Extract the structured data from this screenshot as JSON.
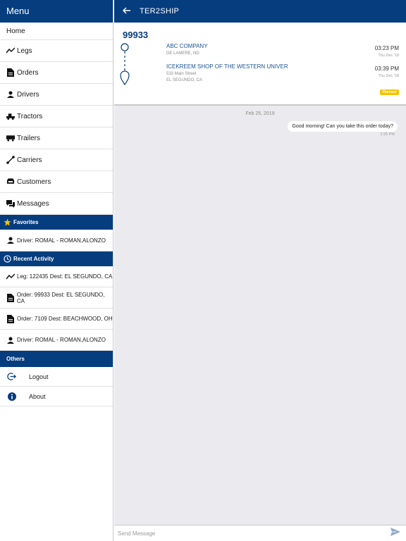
{
  "sidebar": {
    "title": "Menu",
    "home": "Home",
    "items": [
      {
        "label": "Legs",
        "icon": "trend-icon"
      },
      {
        "label": "Orders",
        "icon": "document-icon"
      },
      {
        "label": "Drivers",
        "icon": "person-icon"
      },
      {
        "label": "Tractors",
        "icon": "tractor-icon"
      },
      {
        "label": "Trailers",
        "icon": "trailer-icon"
      },
      {
        "label": "Carriers",
        "icon": "route-icon"
      },
      {
        "label": "Customers",
        "icon": "customers-icon"
      },
      {
        "label": "Messages",
        "icon": "chat-icon"
      }
    ],
    "favorites": {
      "title": "Favorites",
      "items": [
        {
          "label": "Driver: ROMAL - ROMAN,ALONZO"
        }
      ]
    },
    "recent": {
      "title": "Recent Activity",
      "items": [
        {
          "label": "Leg: 122435 Dest: EL SEGUNDO, CA"
        },
        {
          "label": "Order: 99933 Dest: EL SEGUNDO, CA"
        },
        {
          "label": "Order: 7109 Dest: BEACHWOOD, OH"
        },
        {
          "label": "Driver: ROMAL - ROMAN,ALONZO"
        }
      ]
    },
    "others": {
      "title": "Others",
      "logout": "Logout",
      "about": "About"
    }
  },
  "header": {
    "title": "TER2SHIP"
  },
  "order": {
    "number": "99933",
    "status": "Planned",
    "stops": [
      {
        "name": "ABC COMPANY",
        "sub1": "DE LAMERE, ND",
        "sub2": "",
        "time": "03:23 PM",
        "date": "Thu Dec '18"
      },
      {
        "name": "ICEKREEM SHOP OF THE WESTERN UNIVER",
        "sub1": "533 Main Street",
        "sub2": "EL SEGUNDO, CA",
        "time": "03:39 PM",
        "date": "Thu Dec '18"
      }
    ]
  },
  "messages": {
    "date": "Feb 25, 2019",
    "items": [
      {
        "text": "Good morning! Can you take this order today?",
        "time": "2:25 PM"
      }
    ]
  },
  "compose": {
    "placeholder": "Send Message"
  },
  "colors": {
    "primary": "#063d7e",
    "accent": "#1c5496",
    "badge": "#f5c300",
    "background": "#ebebef"
  }
}
